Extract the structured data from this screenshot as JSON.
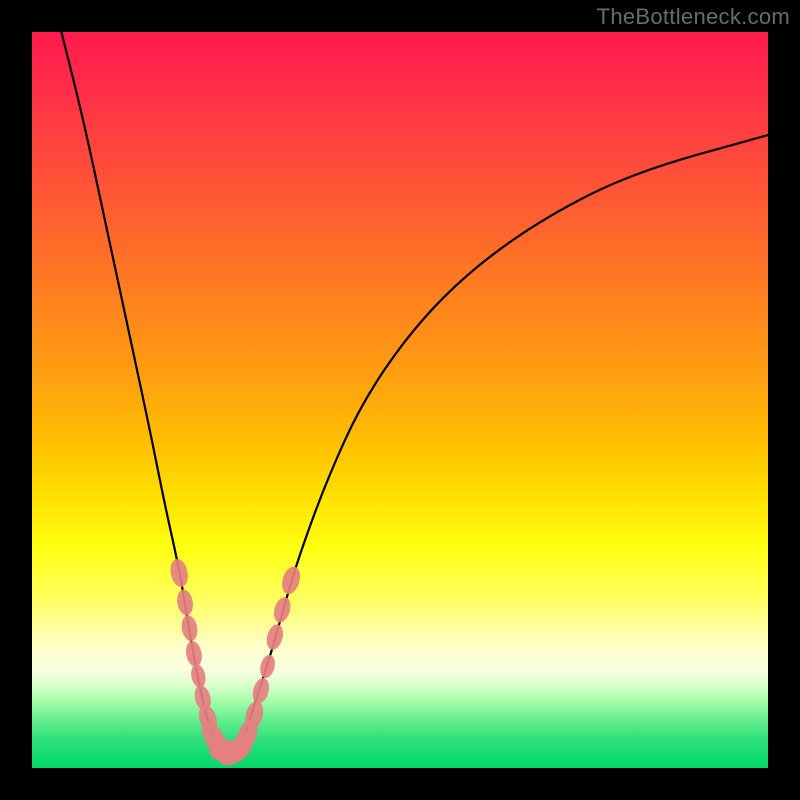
{
  "watermark": "TheBottleneck.com",
  "colors": {
    "page_bg": "#000000",
    "curve_stroke": "#000000",
    "pip_fill": "#e58080",
    "gradient_stops": [
      {
        "offset": 0.0,
        "color": "#ff1a4d"
      },
      {
        "offset": 0.25,
        "color": "#ff6030"
      },
      {
        "offset": 0.5,
        "color": "#ffb008"
      },
      {
        "offset": 0.7,
        "color": "#ffff10"
      },
      {
        "offset": 0.88,
        "color": "#e0ffd0"
      },
      {
        "offset": 1.0,
        "color": "#00d868"
      }
    ]
  },
  "chart_data": {
    "type": "line",
    "title": "",
    "xlabel": "",
    "ylabel": "",
    "xlim": [
      0,
      100
    ],
    "ylim": [
      0,
      100
    ],
    "grid": false,
    "legend": false,
    "series": [
      {
        "name": "left-branch",
        "note": "descending limb of the V; values approximate % height (100=top, 0=bottom)",
        "points": [
          {
            "x": 4,
            "y": 100
          },
          {
            "x": 7,
            "y": 88
          },
          {
            "x": 10,
            "y": 74
          },
          {
            "x": 13,
            "y": 60
          },
          {
            "x": 16,
            "y": 46
          },
          {
            "x": 18,
            "y": 36
          },
          {
            "x": 20,
            "y": 27
          },
          {
            "x": 21,
            "y": 21
          },
          {
            "x": 22,
            "y": 15
          },
          {
            "x": 23,
            "y": 10
          },
          {
            "x": 24,
            "y": 6
          },
          {
            "x": 25,
            "y": 3.5
          },
          {
            "x": 26,
            "y": 2.3
          },
          {
            "x": 27,
            "y": 2
          }
        ]
      },
      {
        "name": "right-branch",
        "note": "ascending limb of the V, flattening toward the right",
        "points": [
          {
            "x": 27,
            "y": 2
          },
          {
            "x": 28,
            "y": 2.6
          },
          {
            "x": 29,
            "y": 4.5
          },
          {
            "x": 30,
            "y": 8
          },
          {
            "x": 32,
            "y": 14
          },
          {
            "x": 34,
            "y": 21
          },
          {
            "x": 36,
            "y": 28
          },
          {
            "x": 40,
            "y": 39
          },
          {
            "x": 45,
            "y": 50
          },
          {
            "x": 52,
            "y": 60
          },
          {
            "x": 60,
            "y": 68
          },
          {
            "x": 70,
            "y": 75
          },
          {
            "x": 82,
            "y": 81
          },
          {
            "x": 100,
            "y": 86
          }
        ]
      }
    ],
    "markers": {
      "name": "pink-pips",
      "note": "thick salmon segment markers near the valley, approx positions (x%,y%) and rough radii",
      "points": [
        {
          "x": 20.0,
          "y": 26.5,
          "r": 1.2
        },
        {
          "x": 20.8,
          "y": 22.5,
          "r": 1.1
        },
        {
          "x": 21.4,
          "y": 19.0,
          "r": 1.1
        },
        {
          "x": 22.0,
          "y": 15.5,
          "r": 1.1
        },
        {
          "x": 22.6,
          "y": 12.5,
          "r": 1.0
        },
        {
          "x": 23.2,
          "y": 9.5,
          "r": 1.1
        },
        {
          "x": 23.9,
          "y": 6.7,
          "r": 1.2
        },
        {
          "x": 24.6,
          "y": 4.4,
          "r": 1.3
        },
        {
          "x": 25.5,
          "y": 3.0,
          "r": 1.4
        },
        {
          "x": 26.5,
          "y": 2.2,
          "r": 1.5
        },
        {
          "x": 27.5,
          "y": 2.2,
          "r": 1.5
        },
        {
          "x": 28.5,
          "y": 3.0,
          "r": 1.4
        },
        {
          "x": 29.3,
          "y": 4.6,
          "r": 1.3
        },
        {
          "x": 30.2,
          "y": 7.2,
          "r": 1.2
        },
        {
          "x": 31.1,
          "y": 10.5,
          "r": 1.1
        },
        {
          "x": 32.0,
          "y": 13.8,
          "r": 1.0
        },
        {
          "x": 33.0,
          "y": 17.8,
          "r": 1.1
        },
        {
          "x": 34.0,
          "y": 21.5,
          "r": 1.1
        },
        {
          "x": 35.2,
          "y": 25.5,
          "r": 1.2
        }
      ]
    }
  }
}
